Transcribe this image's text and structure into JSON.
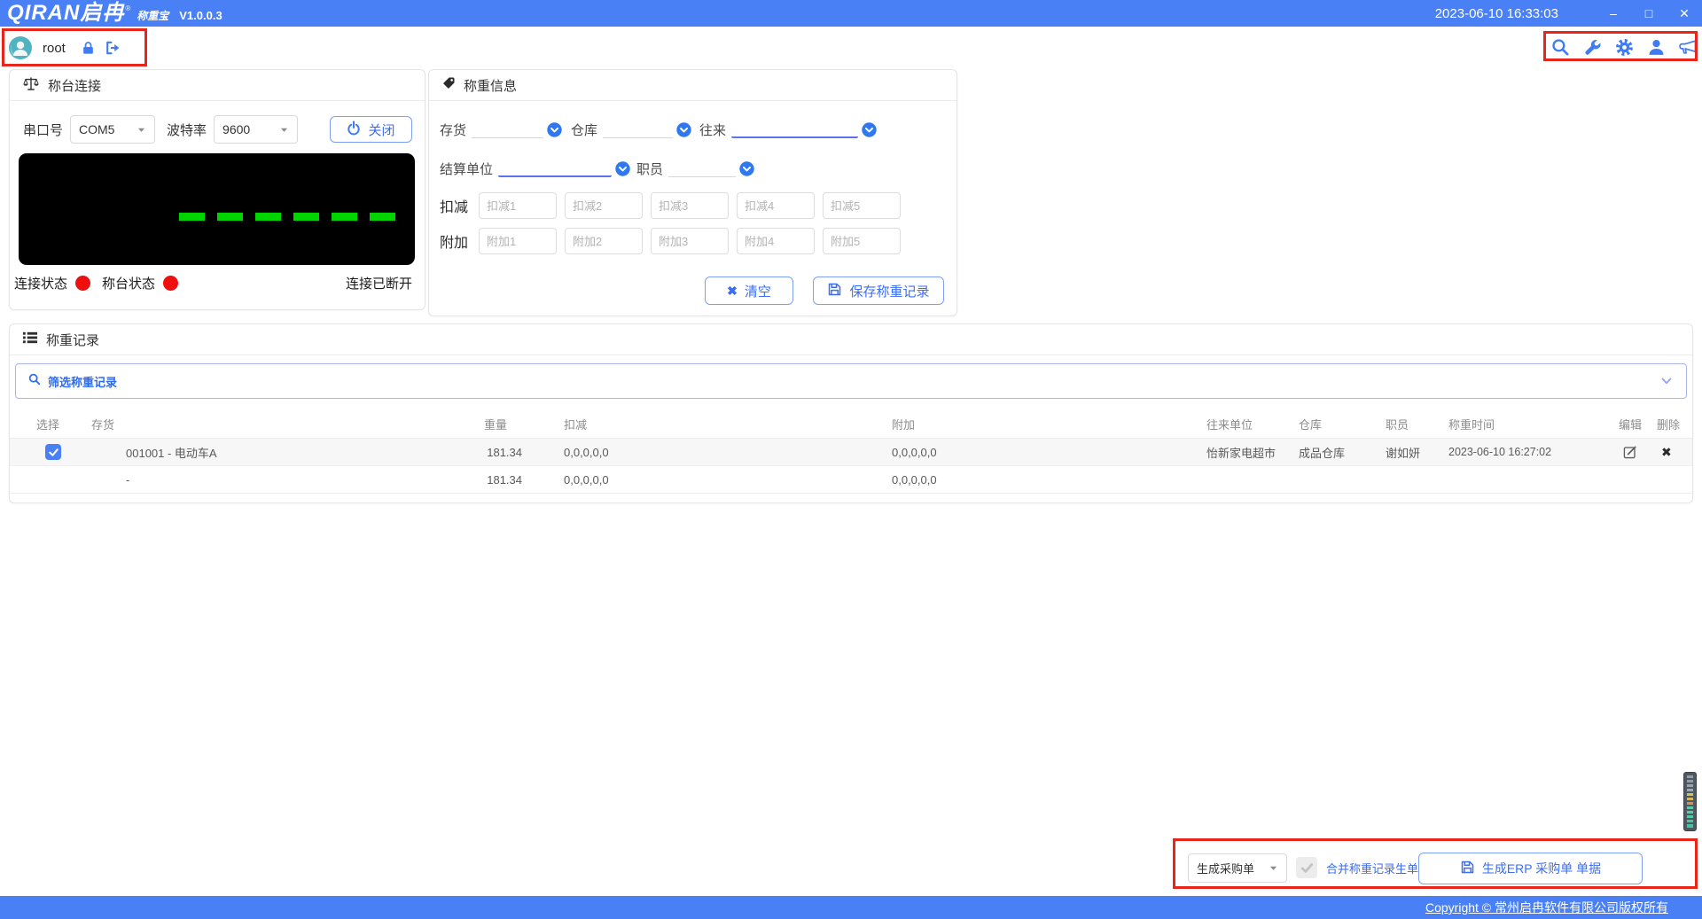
{
  "titlebar": {
    "logo_main": "QIRAN启冉",
    "logo_reg": "®",
    "logo_sub": "称重宝",
    "version": "V1.0.0.3",
    "datetime": "2023-06-10 16:33:03",
    "minimize": "–",
    "maximize": "□",
    "close": "✕"
  },
  "userbar": {
    "username": "root"
  },
  "scale_panel": {
    "title": "称台连接",
    "port_label": "串口号",
    "port_value": "COM5",
    "baud_label": "波特率",
    "baud_value": "9600",
    "close_button": "关闭",
    "conn_status_label": "连接状态",
    "scale_status_label": "称台状态",
    "disconnect_message": "连接已断开"
  },
  "weigh_panel": {
    "title": "称重信息",
    "fields": {
      "inventory": "存货",
      "warehouse": "仓库",
      "partner": "往来",
      "settle": "结算单位",
      "staff": "职员"
    },
    "deduct_label": "扣减",
    "deduct_placeholders": [
      "扣减1",
      "扣减2",
      "扣减3",
      "扣减4",
      "扣减5"
    ],
    "extra_label": "附加",
    "extra_placeholders": [
      "附加1",
      "附加2",
      "附加3",
      "附加4",
      "附加5"
    ],
    "clear_button": "清空",
    "save_button": "保存称重记录"
  },
  "records": {
    "title": "称重记录",
    "filter_label": "筛选称重记录",
    "columns": [
      "选择",
      "存货",
      "重量",
      "扣减",
      "附加",
      "往来单位",
      "仓库",
      "职员",
      "称重时间",
      "编辑",
      "删除"
    ],
    "rows": [
      {
        "selected": true,
        "inventory": "001001 - 电动车A",
        "weight": "181.34",
        "deduct": "0,0,0,0,0",
        "extra": "0,0,0,0,0",
        "partner": "怡新家电超市",
        "warehouse": "成品仓库",
        "staff": "谢如妍",
        "time": "2023-06-10 16:27:02"
      },
      {
        "selected": false,
        "inventory": "-",
        "weight": "181.34",
        "deduct": "0,0,0,0,0",
        "extra": "0,0,0,0,0",
        "partner": "",
        "warehouse": "",
        "staff": "",
        "time": ""
      }
    ]
  },
  "footer_controls": {
    "doc_type_value": "生成采购单",
    "merge_label": "合并称重记录生单",
    "merge_checked": true,
    "merge_enabled": false,
    "erp_button": "生成ERP 采购单 单据"
  },
  "footer": {
    "copyright": "Copyright © 常州启冉软件有限公司版权所有"
  },
  "colors": {
    "accent_blue": "#4a80f5",
    "annotation_red": "#e8251a",
    "status_red": "#ee0f0f",
    "led_green": "#00d500"
  },
  "icons": [
    "search-icon",
    "wrench-icon",
    "gear-icon",
    "user-icon",
    "megaphone-icon",
    "lock-icon",
    "logout-icon",
    "scale-icon",
    "tag-icon",
    "list-icon",
    "power-icon",
    "save-icon",
    "clear-x-icon",
    "edit-icon",
    "delete-x-icon",
    "chevron-down-icon",
    "checkbox"
  ]
}
